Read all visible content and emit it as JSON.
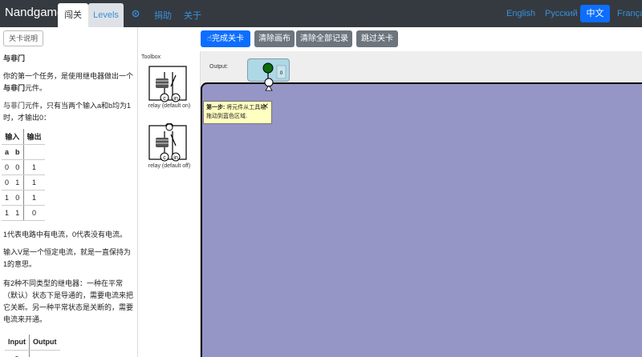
{
  "nav": {
    "brand": "Nandgame",
    "tab_levels_cn": "闯关",
    "tab_levels": "Levels",
    "help": "捐助",
    "about": "关于",
    "languages": [
      "English",
      "Русский",
      "中文",
      "Français"
    ],
    "active_language": "中文"
  },
  "left": {
    "toggle_btn": "关卡说明",
    "title": "与非门",
    "p1_before": "你的第一个任务，是使用继电器做出一个",
    "p1_bold": "与非门",
    "p1_after": "元件。",
    "p2": "与非门元件，只有当两个输入a和b均为1时，才输出0：",
    "table1": {
      "head_in": "输入",
      "head_out": "输出",
      "cols": [
        "a",
        "b"
      ],
      "rows": [
        [
          "0",
          "0",
          "1"
        ],
        [
          "0",
          "1",
          "1"
        ],
        [
          "1",
          "0",
          "1"
        ],
        [
          "1",
          "1",
          "0"
        ]
      ]
    },
    "p3": "1代表电路中有电流，0代表没有电流。",
    "p4": "输入V是一个恒定电流，就是一直保持为1的意思。",
    "p5": "有2种不同类型的继电器：一种在平常（默认）状态下是导通的，需要电流来把它关断。另一种平常状态是关断的，需要电流来开通。",
    "table2": {
      "head_in": "Input",
      "head_out": "Output",
      "partial": "a"
    }
  },
  "toolbar": {
    "done": "完成关卡",
    "clear_canvas": "清除画布",
    "clear_all": "清除全部记录",
    "skip": "跳过关卡"
  },
  "toolbox": {
    "title": "Toolbox",
    "items": [
      {
        "label": "relay (default on)",
        "pins": [
          "c",
          "in"
        ]
      },
      {
        "label": "relay (default off)",
        "pins": [
          "c",
          "in"
        ]
      }
    ]
  },
  "canvas": {
    "output_label": "Output:",
    "output_pin": "0"
  },
  "tooltip": {
    "step": "第一步:",
    "text": " 将元件从工具箱拖动到蓝色区域."
  },
  "colors": {
    "nav_bg": "#343a40",
    "primary": "#0d6efd",
    "secondary": "#6c757d",
    "workarea": "#9595c6",
    "output_box": "#add8e6",
    "tooltip": "#ffffc0"
  }
}
